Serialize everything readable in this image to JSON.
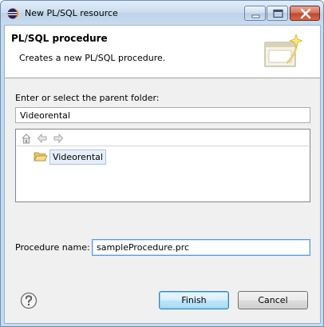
{
  "window": {
    "title": "New PL/SQL resource"
  },
  "banner": {
    "title": "PL/SQL procedure",
    "description": "Creates a new PL/SQL procedure."
  },
  "parent_folder": {
    "label": "Enter or select the parent folder:",
    "value": "Videorental",
    "tree_items": [
      {
        "label": "Videorental",
        "icon": "open-folder-icon",
        "selected": true
      }
    ]
  },
  "procedure": {
    "label": "Procedure name:",
    "value": "sampleProcedure.prc"
  },
  "buttons": {
    "finish": "Finish",
    "cancel": "Cancel"
  },
  "colors": {
    "accent": "#569de5",
    "selection": "#e6eef8",
    "close_button": "#c0442b"
  }
}
